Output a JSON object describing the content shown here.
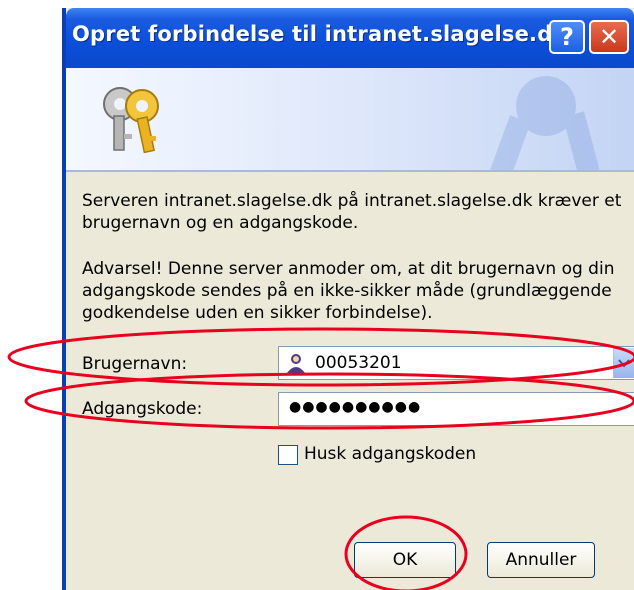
{
  "dialog": {
    "title": "Opret forbindelse til intranet.slagelse.dk",
    "help_glyph": "?",
    "close_glyph": "✕",
    "message": "Serveren intranet.slagelse.dk på intranet.slagelse.dk kræver et brugernavn og en adgangskode.",
    "warning": "Advarsel! Denne server anmoder om, at dit brugernavn og din adgangskode sendes på en ikke-sikker måde (grundlæggende godkendelse uden en sikker forbindelse).",
    "username_label": "Brugernavn:",
    "username_value": "00053201",
    "password_label": "Adgangskode:",
    "password_value": "●●●●●●●●●●",
    "remember_label": "Husk adgangskoden",
    "ok_label": "OK",
    "cancel_label": "Annuller"
  },
  "annotations": {
    "ellipse_color": "#e8001e"
  },
  "icons": [
    "keys-icon",
    "user-icon",
    "dropdown-arrow-icon",
    "help-icon",
    "close-icon"
  ]
}
